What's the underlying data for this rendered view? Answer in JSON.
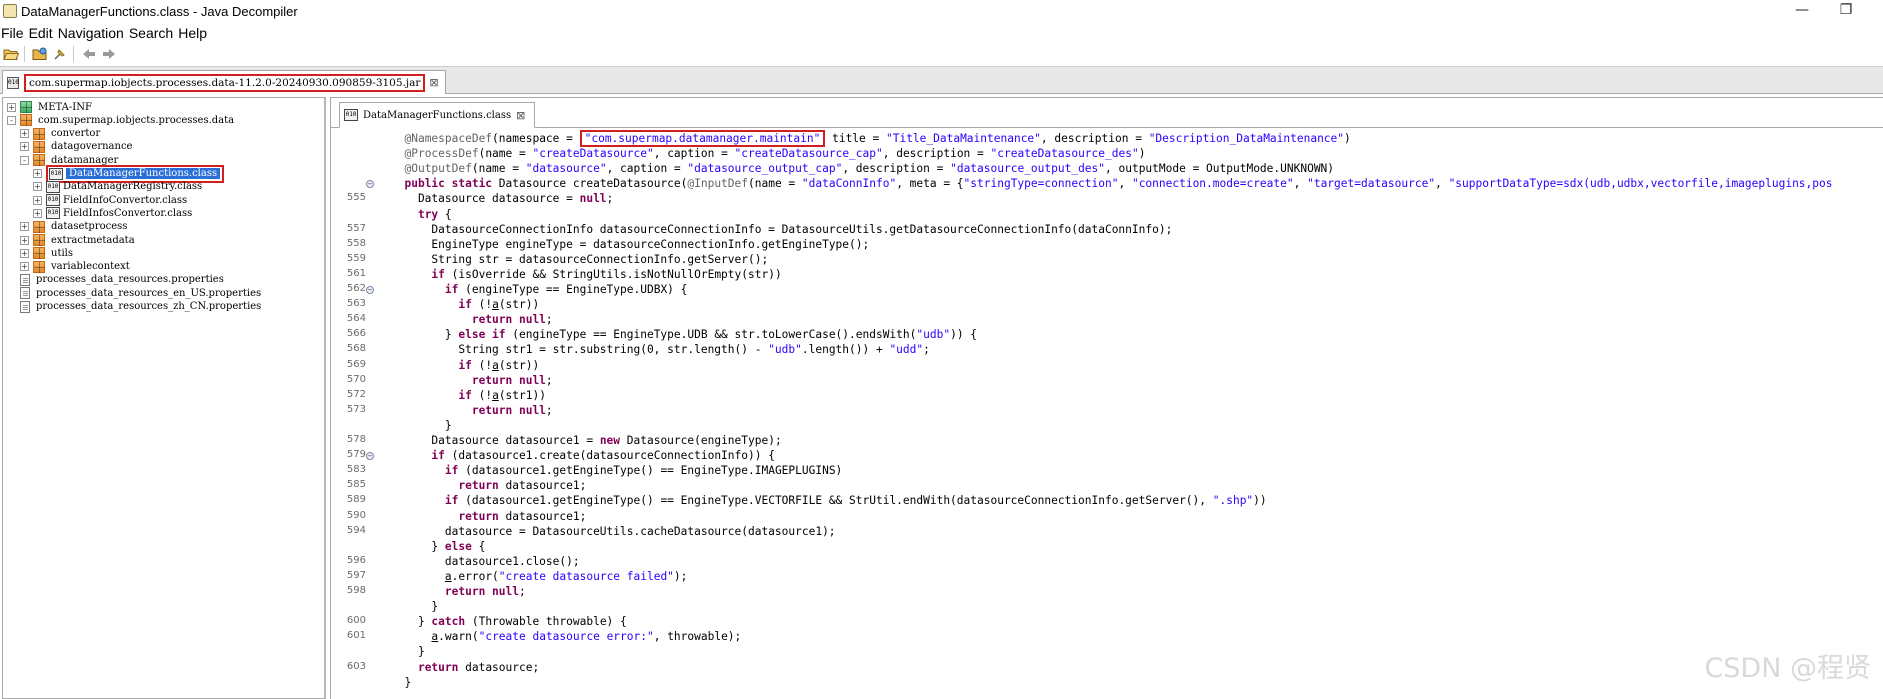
{
  "window": {
    "title": "DataManagerFunctions.class - Java Decompiler",
    "minimize_glyph": "—",
    "restore_glyph": "❐"
  },
  "menu": [
    "File",
    "Edit",
    "Navigation",
    "Search",
    "Help"
  ],
  "toolbar": {
    "icons": [
      "open-folder-icon",
      "open-file-icon",
      "pin-icon",
      "back-arrow-icon",
      "forward-arrow-icon"
    ]
  },
  "jar_tab": {
    "label": "com.supermap.iobjects.processes.data-11.2.0-20240930.090859-3105.jar",
    "close": "⊠"
  },
  "tree": [
    {
      "depth": 0,
      "expander": "+",
      "icon": "green",
      "label": "META-INF"
    },
    {
      "depth": 0,
      "expander": "-",
      "icon": "orange",
      "label": "com.supermap.iobjects.processes.data"
    },
    {
      "depth": 1,
      "expander": "+",
      "icon": "orange",
      "label": "convertor"
    },
    {
      "depth": 1,
      "expander": "+",
      "icon": "orange",
      "label": "datagovernance"
    },
    {
      "depth": 1,
      "expander": "-",
      "icon": "orange",
      "label": "datamanager"
    },
    {
      "depth": 2,
      "expander": "+",
      "icon": "class",
      "label": "DataManagerFunctions.class",
      "selected": true
    },
    {
      "depth": 2,
      "expander": "+",
      "icon": "class",
      "label": "DataManagerRegistry.class"
    },
    {
      "depth": 2,
      "expander": "+",
      "icon": "class",
      "label": "FieldInfoConvertor.class"
    },
    {
      "depth": 2,
      "expander": "+",
      "icon": "class",
      "label": "FieldInfosConvertor.class"
    },
    {
      "depth": 1,
      "expander": "+",
      "icon": "orange",
      "label": "datasetprocess"
    },
    {
      "depth": 1,
      "expander": "+",
      "icon": "orange",
      "label": "extractmetadata"
    },
    {
      "depth": 1,
      "expander": "+",
      "icon": "orange",
      "label": "utils"
    },
    {
      "depth": 1,
      "expander": "+",
      "icon": "orange",
      "label": "variablecontext"
    },
    {
      "depth": 0,
      "expander": "",
      "icon": "file",
      "label": "processes_data_resources.properties"
    },
    {
      "depth": 0,
      "expander": "",
      "icon": "file",
      "label": "processes_data_resources_en_US.properties"
    },
    {
      "depth": 0,
      "expander": "",
      "icon": "file",
      "label": "processes_data_resources_zh_CN.properties"
    }
  ],
  "editor_tab": {
    "label": "DataManagerFunctions.class",
    "close": "⊠"
  },
  "code_lines": [
    {
      "num": "",
      "fold": false,
      "segs": [
        {
          "t": "  "
        },
        {
          "c": "ann",
          "t": "@NamespaceDef"
        },
        {
          "t": "(namespace = "
        },
        {
          "c": "str hl-box",
          "t": "\"com.supermap.datamanager.maintain\""
        },
        {
          "t": " title = "
        },
        {
          "c": "str",
          "t": "\"Title_DataMaintenance\""
        },
        {
          "t": ", description = "
        },
        {
          "c": "str",
          "t": "\"Description_DataMaintenance\""
        },
        {
          "t": ")"
        }
      ]
    },
    {
      "num": "",
      "fold": false,
      "segs": [
        {
          "t": "  "
        },
        {
          "c": "ann",
          "t": "@ProcessDef"
        },
        {
          "t": "(name = "
        },
        {
          "c": "str",
          "t": "\"createDatasource\""
        },
        {
          "t": ", caption = "
        },
        {
          "c": "str",
          "t": "\"createDatasource_cap\""
        },
        {
          "t": ", description = "
        },
        {
          "c": "str",
          "t": "\"createDatasource_des\""
        },
        {
          "t": ")"
        }
      ]
    },
    {
      "num": "",
      "fold": false,
      "segs": [
        {
          "t": "  "
        },
        {
          "c": "ann",
          "t": "@OutputDef"
        },
        {
          "t": "(name = "
        },
        {
          "c": "str",
          "t": "\"datasource\""
        },
        {
          "t": ", caption = "
        },
        {
          "c": "str",
          "t": "\"datasource_output_cap\""
        },
        {
          "t": ", description = "
        },
        {
          "c": "str",
          "t": "\"datasource_output_des\""
        },
        {
          "t": ", outputMode = OutputMode.UNKNOWN)"
        }
      ]
    },
    {
      "num": "",
      "fold": true,
      "segs": [
        {
          "t": "  "
        },
        {
          "c": "kw",
          "t": "public static"
        },
        {
          "t": " Datasource createDatasource("
        },
        {
          "c": "ann",
          "t": "@InputDef"
        },
        {
          "t": "(name = "
        },
        {
          "c": "str",
          "t": "\"dataConnInfo\""
        },
        {
          "t": ", meta = {"
        },
        {
          "c": "str",
          "t": "\"stringType=connection\""
        },
        {
          "t": ", "
        },
        {
          "c": "str",
          "t": "\"connection.mode=create\""
        },
        {
          "t": ", "
        },
        {
          "c": "str",
          "t": "\"target=datasource\""
        },
        {
          "t": ", "
        },
        {
          "c": "str",
          "t": "\"supportDataType=sdx(udb,udbx,vectorfile,imageplugins,pos"
        }
      ]
    },
    {
      "num": "555",
      "fold": false,
      "segs": [
        {
          "t": "    Datasource datasource = "
        },
        {
          "c": "kw",
          "t": "null"
        },
        {
          "t": ";"
        }
      ]
    },
    {
      "num": "",
      "fold": false,
      "segs": [
        {
          "t": "    "
        },
        {
          "c": "kw",
          "t": "try"
        },
        {
          "t": " {"
        }
      ]
    },
    {
      "num": "557",
      "fold": false,
      "segs": [
        {
          "t": "      DatasourceConnectionInfo datasourceConnectionInfo = DatasourceUtils.getDatasourceConnectionInfo(dataConnInfo);"
        }
      ]
    },
    {
      "num": "558",
      "fold": false,
      "segs": [
        {
          "t": "      EngineType engineType = datasourceConnectionInfo.getEngineType();"
        }
      ]
    },
    {
      "num": "559",
      "fold": false,
      "segs": [
        {
          "t": "      String str = datasourceConnectionInfo.getServer();"
        }
      ]
    },
    {
      "num": "561",
      "fold": false,
      "segs": [
        {
          "t": "      "
        },
        {
          "c": "kw",
          "t": "if"
        },
        {
          "t": " (isOverride && StringUtils.isNotNullOrEmpty(str))"
        }
      ]
    },
    {
      "num": "562",
      "fold": true,
      "segs": [
        {
          "t": "        "
        },
        {
          "c": "kw",
          "t": "if"
        },
        {
          "t": " (engineType == EngineType.UDBX) {"
        }
      ]
    },
    {
      "num": "563",
      "fold": false,
      "segs": [
        {
          "t": "          "
        },
        {
          "c": "kw",
          "t": "if"
        },
        {
          "t": " (!"
        },
        {
          "c": "ul",
          "t": "a"
        },
        {
          "t": "(str))"
        }
      ]
    },
    {
      "num": "564",
      "fold": false,
      "segs": [
        {
          "t": "            "
        },
        {
          "c": "kw",
          "t": "return null"
        },
        {
          "t": ";"
        }
      ]
    },
    {
      "num": "566",
      "fold": false,
      "segs": [
        {
          "t": "        } "
        },
        {
          "c": "kw",
          "t": "else if"
        },
        {
          "t": " (engineType == EngineType.UDB && str.toLowerCase().endsWith("
        },
        {
          "c": "str",
          "t": "\"udb\""
        },
        {
          "t": ")) {"
        }
      ]
    },
    {
      "num": "568",
      "fold": false,
      "segs": [
        {
          "t": "          String str1 = str.substring(0, str.length() - "
        },
        {
          "c": "str",
          "t": "\"udb\""
        },
        {
          "t": ".length()) + "
        },
        {
          "c": "str",
          "t": "\"udd\""
        },
        {
          "t": ";"
        }
      ]
    },
    {
      "num": "569",
      "fold": false,
      "segs": [
        {
          "t": "          "
        },
        {
          "c": "kw",
          "t": "if"
        },
        {
          "t": " (!"
        },
        {
          "c": "ul",
          "t": "a"
        },
        {
          "t": "(str))"
        }
      ]
    },
    {
      "num": "570",
      "fold": false,
      "segs": [
        {
          "t": "            "
        },
        {
          "c": "kw",
          "t": "return null"
        },
        {
          "t": ";"
        }
      ]
    },
    {
      "num": "572",
      "fold": false,
      "segs": [
        {
          "t": "          "
        },
        {
          "c": "kw",
          "t": "if"
        },
        {
          "t": " (!"
        },
        {
          "c": "ul",
          "t": "a"
        },
        {
          "t": "(str1))"
        }
      ]
    },
    {
      "num": "573",
      "fold": false,
      "segs": [
        {
          "t": "            "
        },
        {
          "c": "kw",
          "t": "return null"
        },
        {
          "t": ";"
        }
      ]
    },
    {
      "num": "",
      "fold": false,
      "segs": [
        {
          "t": "        }"
        }
      ]
    },
    {
      "num": "578",
      "fold": false,
      "segs": [
        {
          "t": "      Datasource datasource1 = "
        },
        {
          "c": "kw",
          "t": "new"
        },
        {
          "t": " Datasource(engineType);"
        }
      ]
    },
    {
      "num": "579",
      "fold": true,
      "segs": [
        {
          "t": "      "
        },
        {
          "c": "kw",
          "t": "if"
        },
        {
          "t": " (datasource1.create(datasourceConnectionInfo)) {"
        }
      ]
    },
    {
      "num": "583",
      "fold": false,
      "segs": [
        {
          "t": "        "
        },
        {
          "c": "kw",
          "t": "if"
        },
        {
          "t": " (datasource1.getEngineType() == EngineType.IMAGEPLUGINS)"
        }
      ]
    },
    {
      "num": "585",
      "fold": false,
      "segs": [
        {
          "t": "          "
        },
        {
          "c": "kw",
          "t": "return"
        },
        {
          "t": " datasource1;"
        }
      ]
    },
    {
      "num": "589",
      "fold": false,
      "segs": [
        {
          "t": "        "
        },
        {
          "c": "kw",
          "t": "if"
        },
        {
          "t": " (datasource1.getEngineType() == EngineType.VECTORFILE && StrUtil.endWith(datasourceConnectionInfo.getServer(), "
        },
        {
          "c": "str",
          "t": "\".shp\""
        },
        {
          "t": "))"
        }
      ]
    },
    {
      "num": "590",
      "fold": false,
      "segs": [
        {
          "t": "          "
        },
        {
          "c": "kw",
          "t": "return"
        },
        {
          "t": " datasource1;"
        }
      ]
    },
    {
      "num": "594",
      "fold": false,
      "segs": [
        {
          "t": "        datasource = DatasourceUtils.cacheDatasource(datasource1);"
        }
      ]
    },
    {
      "num": "",
      "fold": false,
      "segs": [
        {
          "t": "      } "
        },
        {
          "c": "kw",
          "t": "else"
        },
        {
          "t": " {"
        }
      ]
    },
    {
      "num": "596",
      "fold": false,
      "segs": [
        {
          "t": "        datasource1.close();"
        }
      ]
    },
    {
      "num": "597",
      "fold": false,
      "segs": [
        {
          "t": "        "
        },
        {
          "c": "ul",
          "t": "a"
        },
        {
          "t": ".error("
        },
        {
          "c": "str",
          "t": "\"create datasource failed\""
        },
        {
          "t": ");"
        }
      ]
    },
    {
      "num": "598",
      "fold": false,
      "segs": [
        {
          "t": "        "
        },
        {
          "c": "kw",
          "t": "return null"
        },
        {
          "t": ";"
        }
      ]
    },
    {
      "num": "",
      "fold": false,
      "segs": [
        {
          "t": "      }"
        }
      ]
    },
    {
      "num": "600",
      "fold": false,
      "segs": [
        {
          "t": "    } "
        },
        {
          "c": "kw",
          "t": "catch"
        },
        {
          "t": " (Throwable throwable) {"
        }
      ]
    },
    {
      "num": "601",
      "fold": false,
      "segs": [
        {
          "t": "      "
        },
        {
          "c": "ul",
          "t": "a"
        },
        {
          "t": ".warn("
        },
        {
          "c": "str",
          "t": "\"create datasource error:\""
        },
        {
          "t": ", throwable);"
        }
      ]
    },
    {
      "num": "",
      "fold": false,
      "segs": [
        {
          "t": "    }"
        }
      ]
    },
    {
      "num": "603",
      "fold": false,
      "segs": [
        {
          "t": "    "
        },
        {
          "c": "kw",
          "t": "return"
        },
        {
          "t": " datasource;"
        }
      ]
    },
    {
      "num": "",
      "fold": false,
      "segs": [
        {
          "t": "  }"
        }
      ]
    }
  ],
  "watermark": "CSDN @程贤"
}
